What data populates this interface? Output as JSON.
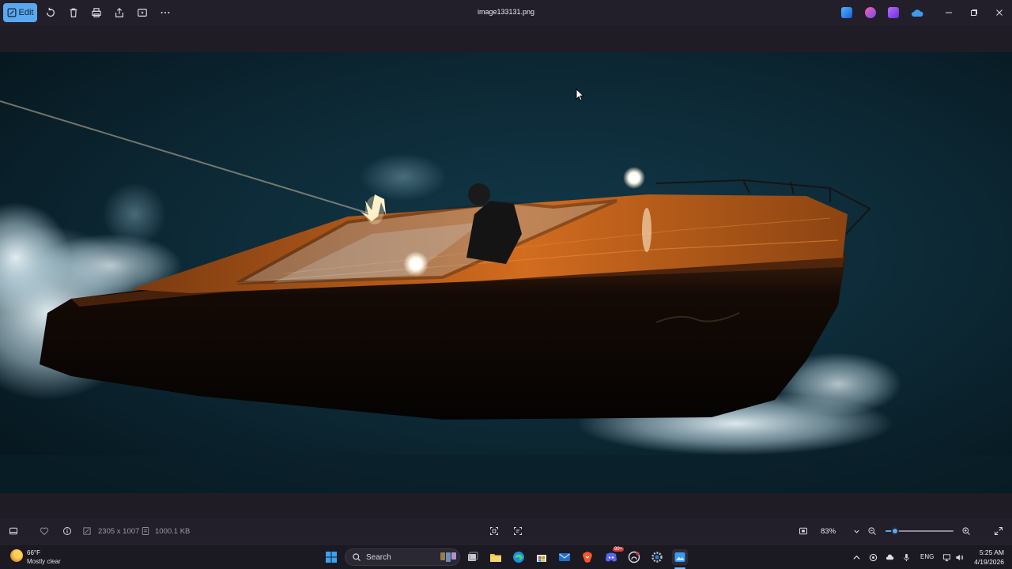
{
  "titlebar": {
    "edit_label": "Edit",
    "file_name": "image133131.png",
    "toolbar_icons": [
      "rotate-icon",
      "delete-icon",
      "print-icon",
      "share-icon",
      "slideshow-icon",
      "more-icon"
    ],
    "app_icons": [
      "photos-editor-icon",
      "copilot-icon",
      "clipchamp-icon",
      "onedrive-icon"
    ],
    "window_controls": [
      "minimize-icon",
      "restore-icon",
      "close-icon"
    ]
  },
  "image": {
    "description_icon": "boat-photo"
  },
  "statusbar": {
    "dimensions": "2305 x 1007",
    "file_size": "1000.1 KB",
    "zoom": "83%",
    "zoom_fraction": 0.14,
    "icons": [
      "filmstrip-icon",
      "favorite-icon",
      "info-icon",
      "dimensions-icon",
      "size-icon",
      "ocr-icon",
      "visual-search-icon",
      "fit-icon",
      "zoom-out-icon",
      "zoom-in-icon",
      "fullscreen-icon"
    ]
  },
  "taskbar": {
    "weather_temp": "66°F",
    "weather_cond": "Mostly clear",
    "search_placeholder": "Search",
    "lang": "ENG",
    "time": "5:25 AM",
    "date": "4/19/2026",
    "pinned": [
      "start-icon",
      "task-view-icon",
      "file-explorer-icon",
      "edge-icon",
      "store-icon",
      "mail-icon",
      "brave-icon",
      "discord-icon",
      "github-icon",
      "settings-icon",
      "photos-icon"
    ],
    "discord_badge": "99+"
  },
  "colors": {
    "accent": "#5aa9f0",
    "water": "#0c2430",
    "hull": "#0a0605",
    "deck": "#c4631a"
  }
}
